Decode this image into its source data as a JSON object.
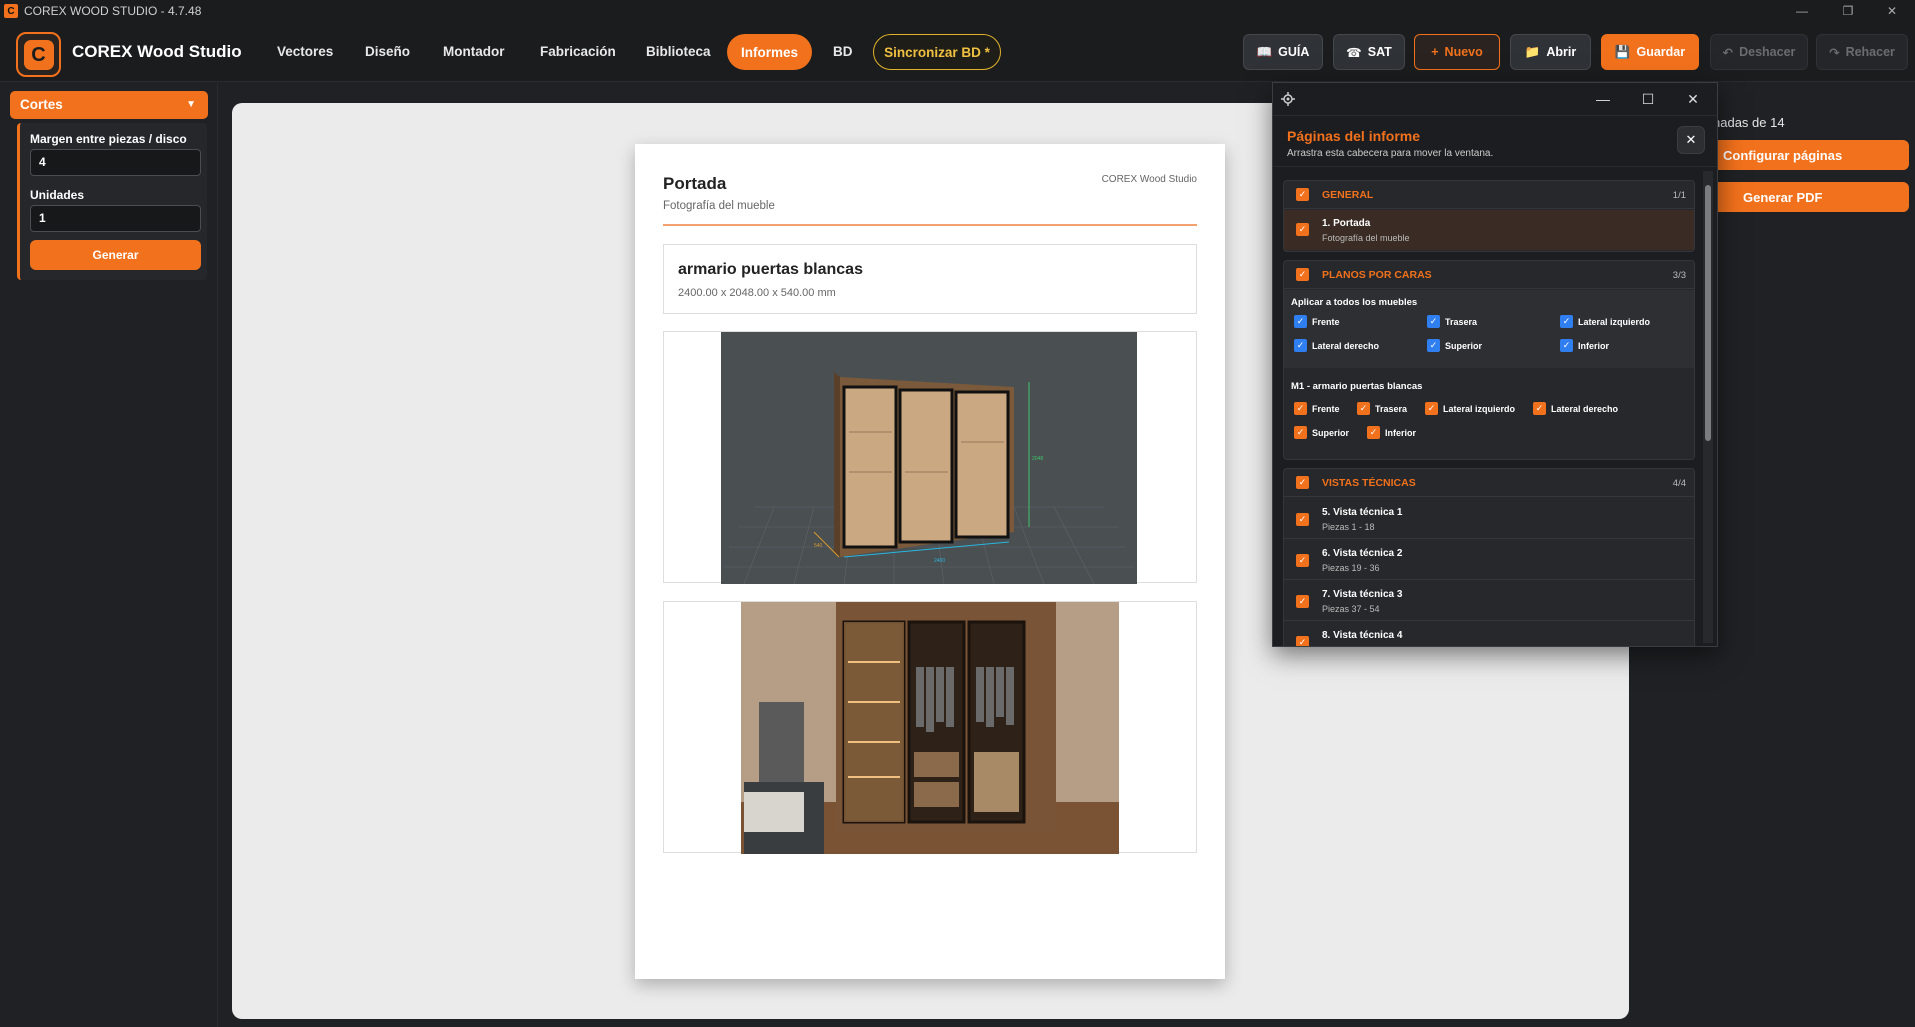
{
  "window": {
    "title": "COREX WOOD STUDIO - 4.7.48",
    "app_icon": "C",
    "controls": [
      "—",
      "❐",
      "✕"
    ]
  },
  "topnav": {
    "logo_letter": "C",
    "brand": "COREX Wood Studio",
    "items": [
      "Vectores",
      "Diseño",
      "Montador",
      "Fabricación",
      "Biblioteca",
      "Informes",
      "BD"
    ],
    "active": "Informes",
    "sync": "Sincronizar BD *",
    "buttons": [
      {
        "icon": "book-icon",
        "glyph": "📖",
        "label": "GUÍA"
      },
      {
        "icon": "phone-icon",
        "glyph": "☎",
        "label": "SAT"
      },
      {
        "icon": "plus-icon",
        "glyph": "+",
        "label": "Nuevo"
      },
      {
        "icon": "folder-icon",
        "glyph": "📁",
        "label": "Abrir"
      },
      {
        "icon": "save-icon",
        "glyph": "💾",
        "label": "Guardar"
      },
      {
        "icon": "undo-icon",
        "glyph": "↶",
        "label": "Deshacer"
      },
      {
        "icon": "redo-icon",
        "glyph": "↷",
        "label": "Rehacer"
      }
    ]
  },
  "sidebar": {
    "section": "Cortes",
    "caret": "▼",
    "margin_label": "Margen entre piezas / disco",
    "margin_value": "4",
    "units_label": "Unidades",
    "units_value": "1",
    "generate": "Generar"
  },
  "page": {
    "title": "Portada",
    "subtitle": "Fotografía del mueble",
    "brand": "COREX Wood Studio",
    "furniture_name": "armario puertas blancas",
    "dimensions": "2400.00 x 2048.00 x 540.00 mm",
    "dim_labels": [
      "2048",
      "2400",
      "540"
    ]
  },
  "right_panel": {
    "text": "nadas de 14",
    "configure": "Configurar páginas",
    "generate_pdf": "Generar PDF"
  },
  "dialog": {
    "title": "Páginas del informe",
    "hint": "Arrastra esta cabecera para mover la ventana.",
    "close": "✕",
    "controls": [
      "—",
      "☐",
      "✕"
    ],
    "general": {
      "title": "GENERAL",
      "count": "1/1",
      "items": [
        {
          "name": "1. Portada",
          "sub": "Fotografía del mueble"
        }
      ]
    },
    "planos": {
      "title": "PLANOS POR CARAS",
      "count": "3/3",
      "apply_all": "Aplicar a todos los muebles",
      "all_faces": [
        "Frente",
        "Trasera",
        "Lateral izquierdo",
        "Lateral derecho",
        "Superior",
        "Inferior"
      ],
      "furniture": "M1 - armario puertas blancas",
      "faces": [
        "Frente",
        "Trasera",
        "Lateral izquierdo",
        "Lateral derecho",
        "Superior",
        "Inferior"
      ]
    },
    "vistas": {
      "title": "VISTAS TÉCNICAS",
      "count": "4/4",
      "items": [
        {
          "name": "5. Vista técnica 1",
          "sub": "Piezas 1 - 18"
        },
        {
          "name": "6. Vista técnica 2",
          "sub": "Piezas 19 - 36"
        },
        {
          "name": "7. Vista técnica 3",
          "sub": "Piezas 37 - 54"
        },
        {
          "name": "8. Vista técnica 4",
          "sub": ""
        }
      ]
    }
  },
  "colors": {
    "accent": "#f2711c",
    "background": "#1f2124",
    "checkbox_blue": "#2f7ff0",
    "sync": "#f0c040"
  }
}
